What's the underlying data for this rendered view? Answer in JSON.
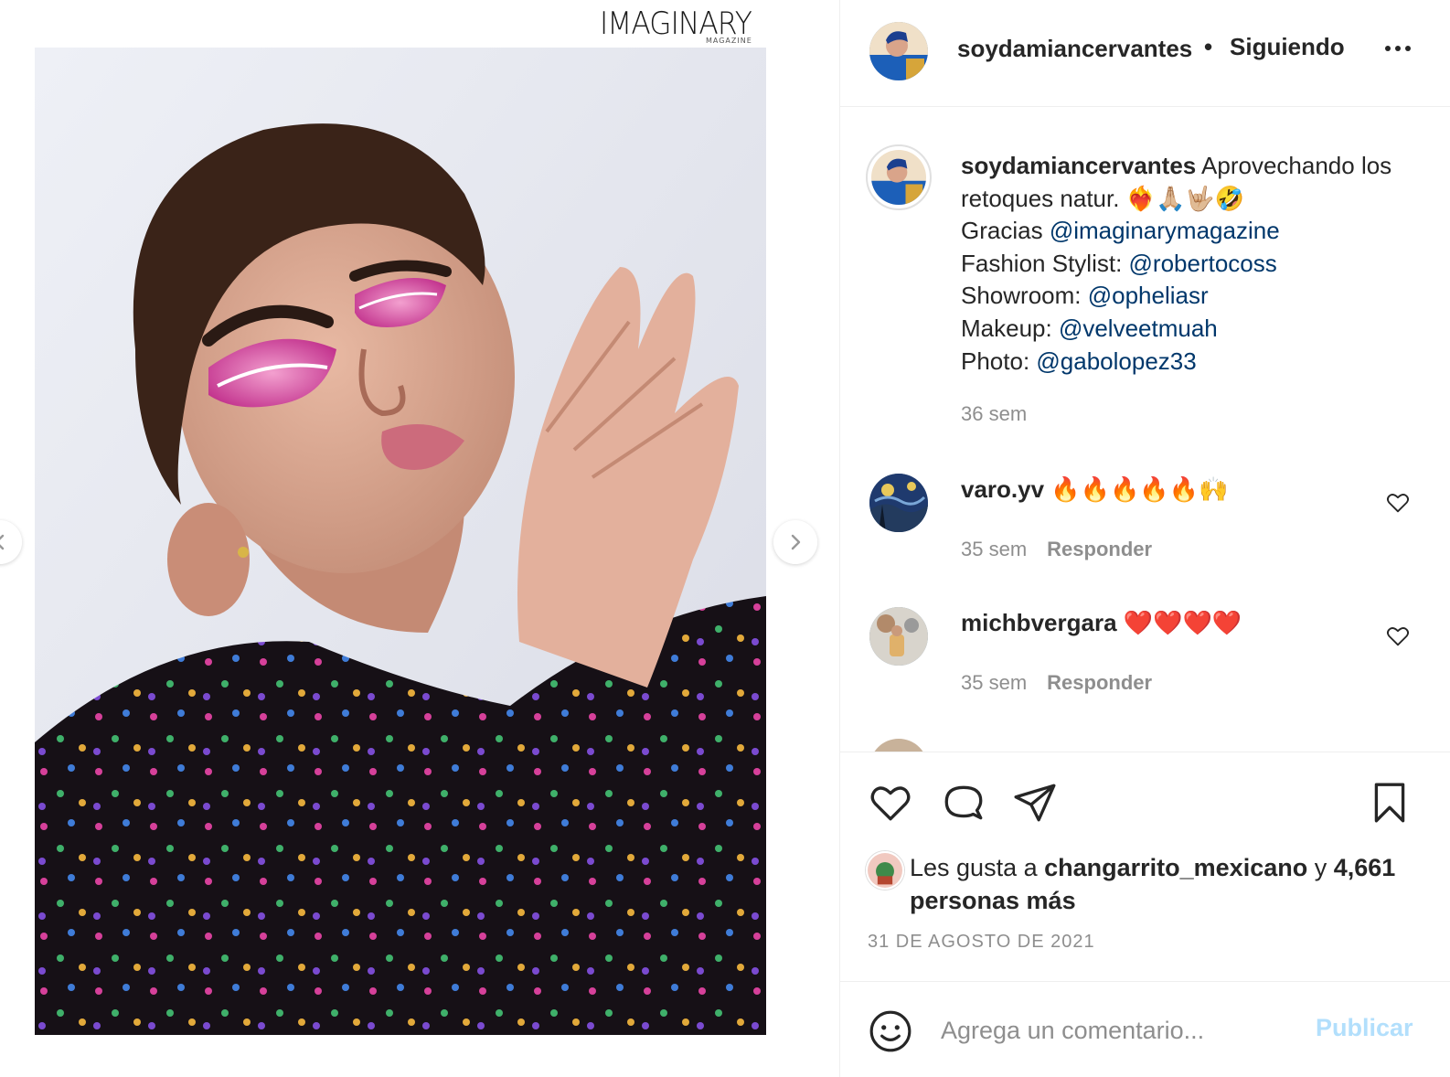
{
  "media": {
    "magazine_name": "IMAGINARY",
    "magazine_sub": "MAGAZINE"
  },
  "header": {
    "username": "soydamiancervantes",
    "separator": "•",
    "follow_status": "Siguiendo"
  },
  "caption": {
    "username": "soydamiancervantes",
    "line1": " Aprovechando los retoques natur. ❤️‍🔥🙏🏼🤟🏼🤣",
    "gracias_label": "Gracias ",
    "gracias_mention": "@imaginarymagazine",
    "stylist_label": "Fashion Stylist: ",
    "stylist_mention": "@robertocoss",
    "showroom_label": "Showroom: ",
    "showroom_mention": "@opheliasr",
    "makeup_label": "Makeup: ",
    "makeup_mention": "@velveetmuah",
    "photo_label": "Photo: ",
    "photo_mention": "@gabolopez33",
    "time": "36 sem"
  },
  "comments": [
    {
      "username": "varo.yv",
      "text": "🔥🔥🔥🔥🔥🙌",
      "time": "35 sem",
      "reply": "Responder"
    },
    {
      "username": "michbvergara",
      "text": "❤️❤️❤️❤️",
      "time": "35 sem",
      "reply": "Responder"
    }
  ],
  "likes": {
    "prefix": "Les gusta a ",
    "user": "changarrito_mexicano",
    "middle": " y ",
    "others": "4,661 personas más"
  },
  "date": "31 DE AGOSTO DE 2021",
  "add_comment": {
    "placeholder": "Agrega un comentario...",
    "publish_label": "Publicar"
  },
  "colors": {
    "link": "#00376b",
    "secondary_text": "#8e8e8e",
    "publish_disabled": "#b2dffc",
    "divider": "#efefef"
  },
  "icons": [
    "chevron-left-icon",
    "chevron-right-icon",
    "more-icon",
    "heart-icon",
    "comment-icon",
    "share-icon",
    "bookmark-icon",
    "emoji-icon"
  ]
}
